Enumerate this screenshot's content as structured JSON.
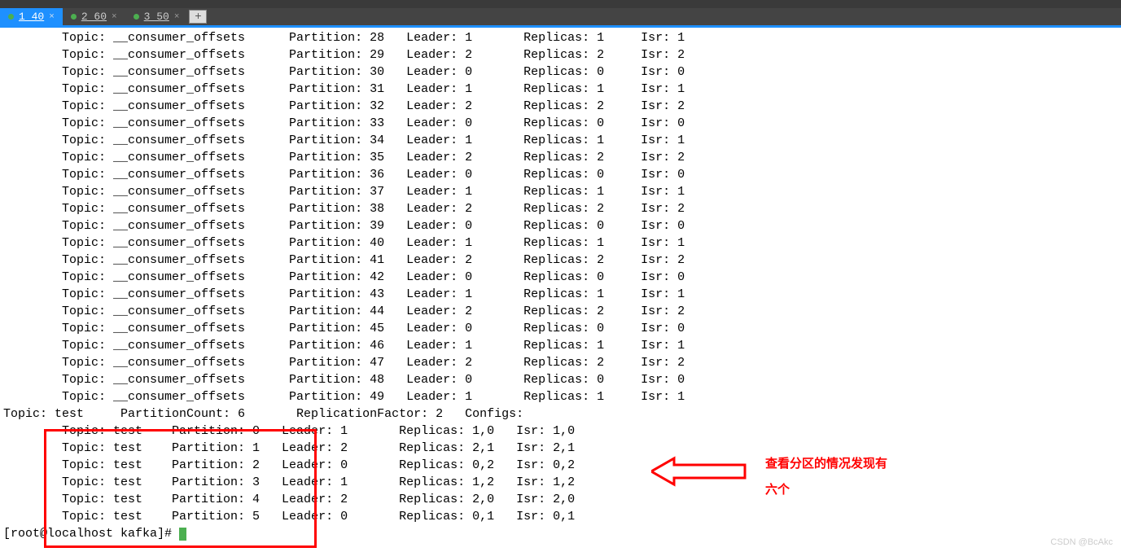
{
  "tabs": [
    {
      "label": "1 40",
      "active": true
    },
    {
      "label": "2 60",
      "active": false
    },
    {
      "label": "3 50",
      "active": false
    }
  ],
  "new_tab_glyph": "+",
  "close_glyph": "×",
  "consumer_offsets": [
    {
      "topic": "__consumer_offsets",
      "partition": 28,
      "leader": 1,
      "replicas": "1",
      "isr": "1"
    },
    {
      "topic": "__consumer_offsets",
      "partition": 29,
      "leader": 2,
      "replicas": "2",
      "isr": "2"
    },
    {
      "topic": "__consumer_offsets",
      "partition": 30,
      "leader": 0,
      "replicas": "0",
      "isr": "0"
    },
    {
      "topic": "__consumer_offsets",
      "partition": 31,
      "leader": 1,
      "replicas": "1",
      "isr": "1"
    },
    {
      "topic": "__consumer_offsets",
      "partition": 32,
      "leader": 2,
      "replicas": "2",
      "isr": "2"
    },
    {
      "topic": "__consumer_offsets",
      "partition": 33,
      "leader": 0,
      "replicas": "0",
      "isr": "0"
    },
    {
      "topic": "__consumer_offsets",
      "partition": 34,
      "leader": 1,
      "replicas": "1",
      "isr": "1"
    },
    {
      "topic": "__consumer_offsets",
      "partition": 35,
      "leader": 2,
      "replicas": "2",
      "isr": "2"
    },
    {
      "topic": "__consumer_offsets",
      "partition": 36,
      "leader": 0,
      "replicas": "0",
      "isr": "0"
    },
    {
      "topic": "__consumer_offsets",
      "partition": 37,
      "leader": 1,
      "replicas": "1",
      "isr": "1"
    },
    {
      "topic": "__consumer_offsets",
      "partition": 38,
      "leader": 2,
      "replicas": "2",
      "isr": "2"
    },
    {
      "topic": "__consumer_offsets",
      "partition": 39,
      "leader": 0,
      "replicas": "0",
      "isr": "0"
    },
    {
      "topic": "__consumer_offsets",
      "partition": 40,
      "leader": 1,
      "replicas": "1",
      "isr": "1"
    },
    {
      "topic": "__consumer_offsets",
      "partition": 41,
      "leader": 2,
      "replicas": "2",
      "isr": "2"
    },
    {
      "topic": "__consumer_offsets",
      "partition": 42,
      "leader": 0,
      "replicas": "0",
      "isr": "0"
    },
    {
      "topic": "__consumer_offsets",
      "partition": 43,
      "leader": 1,
      "replicas": "1",
      "isr": "1"
    },
    {
      "topic": "__consumer_offsets",
      "partition": 44,
      "leader": 2,
      "replicas": "2",
      "isr": "2"
    },
    {
      "topic": "__consumer_offsets",
      "partition": 45,
      "leader": 0,
      "replicas": "0",
      "isr": "0"
    },
    {
      "topic": "__consumer_offsets",
      "partition": 46,
      "leader": 1,
      "replicas": "1",
      "isr": "1"
    },
    {
      "topic": "__consumer_offsets",
      "partition": 47,
      "leader": 2,
      "replicas": "2",
      "isr": "2"
    },
    {
      "topic": "__consumer_offsets",
      "partition": 48,
      "leader": 0,
      "replicas": "0",
      "isr": "0"
    },
    {
      "topic": "__consumer_offsets",
      "partition": 49,
      "leader": 1,
      "replicas": "1",
      "isr": "1"
    }
  ],
  "test_header": {
    "topic": "test",
    "partition_count": 6,
    "replication_factor": 2,
    "configs": ""
  },
  "test_partitions": [
    {
      "topic": "test",
      "partition": 0,
      "leader": 1,
      "replicas": "1,0",
      "isr": "1,0"
    },
    {
      "topic": "test",
      "partition": 1,
      "leader": 2,
      "replicas": "2,1",
      "isr": "2,1"
    },
    {
      "topic": "test",
      "partition": 2,
      "leader": 0,
      "replicas": "0,2",
      "isr": "0,2"
    },
    {
      "topic": "test",
      "partition": 3,
      "leader": 1,
      "replicas": "1,2",
      "isr": "1,2"
    },
    {
      "topic": "test",
      "partition": 4,
      "leader": 2,
      "replicas": "2,0",
      "isr": "2,0"
    },
    {
      "topic": "test",
      "partition": 5,
      "leader": 0,
      "replicas": "0,1",
      "isr": "0,1"
    }
  ],
  "prompt": "[root@localhost kafka]# ",
  "annotation": {
    "line1": "查看分区的情况发现有",
    "line2": "六个"
  },
  "watermark": "CSDN @BcAkc",
  "labels": {
    "topic": "Topic:",
    "partition": "Partition:",
    "leader": "Leader:",
    "replicas": "Replicas:",
    "isr": "Isr:",
    "partition_count": "PartitionCount:",
    "replication_factor": "ReplicationFactor:",
    "configs": "Configs:"
  }
}
